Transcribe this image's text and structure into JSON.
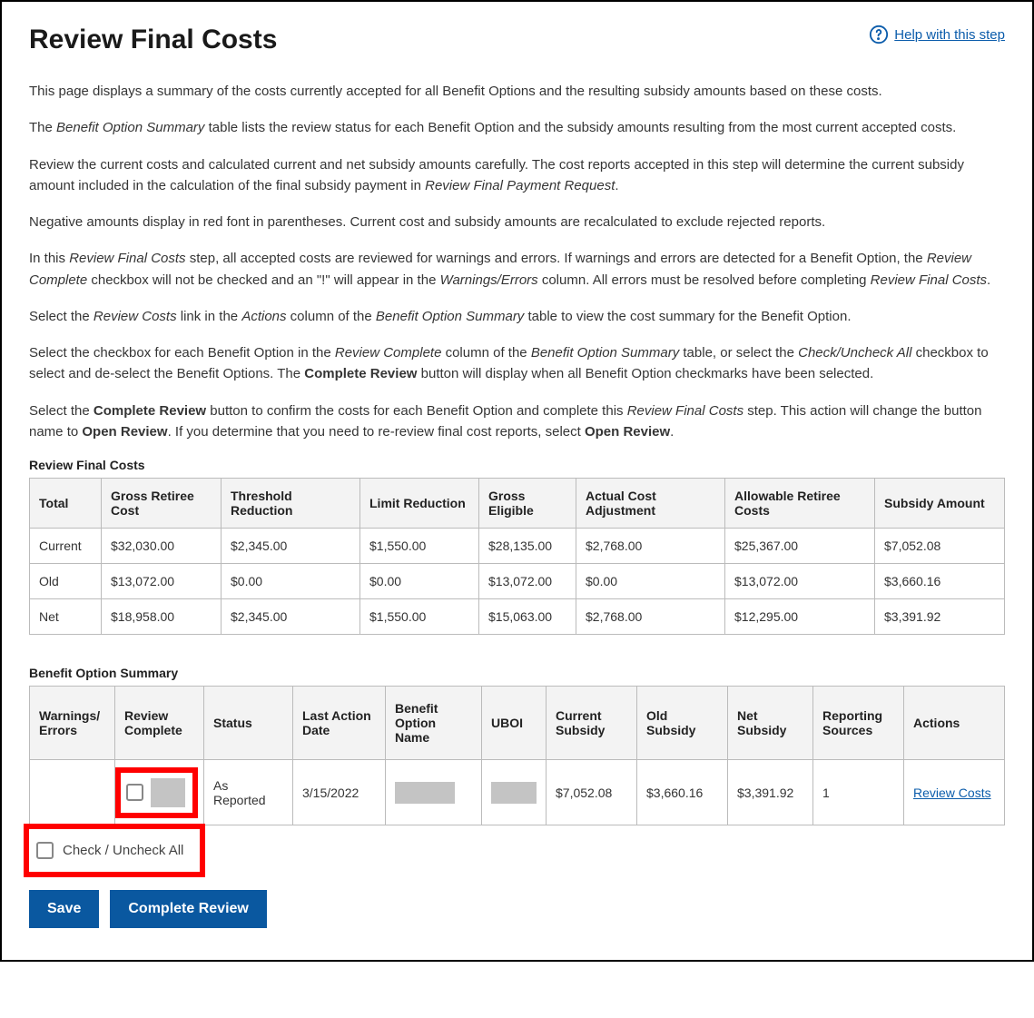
{
  "header": {
    "title": "Review Final Costs",
    "help_label": "Help with this step"
  },
  "intro": {
    "p1": "This page displays a summary of the costs currently accepted for all Benefit Options and the resulting subsidy amounts based on these costs.",
    "p2_a": "The ",
    "p2_b": "Benefit Option Summary",
    "p2_c": " table lists the review status for each Benefit Option and the subsidy amounts resulting from the most current accepted costs.",
    "p3_a": "Review the current costs and calculated current and net subsidy amounts carefully. The cost reports accepted in this step will determine the current subsidy amount included in the calculation of the final subsidy payment in ",
    "p3_b": "Review Final Payment Request",
    "p3_c": ".",
    "p4": "Negative amounts display in red font in parentheses. Current cost and subsidy amounts are recalculated to exclude rejected reports.",
    "p5_a": "In this ",
    "p5_b": "Review Final Costs",
    "p5_c": " step, all accepted costs are reviewed for warnings and errors. If warnings and errors are detected for a Benefit Option, the ",
    "p5_d": "Review Complete",
    "p5_e": " checkbox will not be checked and an \"!\" will appear in the ",
    "p5_f": "Warnings/Errors",
    "p5_g": " column. All errors must be resolved before completing ",
    "p5_h": "Review Final Costs",
    "p5_i": ".",
    "p6_a": "Select the ",
    "p6_b": "Review Costs",
    "p6_c": " link in the ",
    "p6_d": "Actions",
    "p6_e": " column of the ",
    "p6_f": "Benefit Option Summary",
    "p6_g": " table to view the cost summary for the Benefit Option.",
    "p7_a": "Select the checkbox for each Benefit Option in the ",
    "p7_b": "Review Complete",
    "p7_c": " column of the ",
    "p7_d": "Benefit Option Summary",
    "p7_e": " table, or select the ",
    "p7_f": "Check/Uncheck All",
    "p7_g": " checkbox to select and de-select the Benefit Options. The ",
    "p7_h": "Complete Review",
    "p7_i": " button will display when all Benefit Option checkmarks have been selected.",
    "p8_a": "Select the ",
    "p8_b": "Complete Review",
    "p8_c": " button to confirm the costs for each Benefit Option and complete this ",
    "p8_d": "Review Final Costs",
    "p8_e": " step. This action will change the button name to ",
    "p8_f": "Open Review",
    "p8_g": ". If you determine that you need to re-review final cost reports, select ",
    "p8_h": "Open Review",
    "p8_i": "."
  },
  "cost_table": {
    "caption": "Review Final Costs",
    "headers": {
      "total": "Total",
      "gross_retiree": "Gross Retiree Cost",
      "threshold": "Threshold Reduction",
      "limit": "Limit Reduction",
      "gross_eligible": "Gross Eligible",
      "actual_adj": "Actual Cost Adjustment",
      "allowable": "Allowable Retiree Costs",
      "subsidy": "Subsidy Amount"
    },
    "rows": [
      {
        "label": "Current",
        "gross_retiree": "$32,030.00",
        "threshold": "$2,345.00",
        "limit": "$1,550.00",
        "gross_eligible": "$28,135.00",
        "actual_adj": "$2,768.00",
        "allowable": "$25,367.00",
        "subsidy": "$7,052.08"
      },
      {
        "label": "Old",
        "gross_retiree": "$13,072.00",
        "threshold": "$0.00",
        "limit": "$0.00",
        "gross_eligible": "$13,072.00",
        "actual_adj": "$0.00",
        "allowable": "$13,072.00",
        "subsidy": "$3,660.16"
      },
      {
        "label": "Net",
        "gross_retiree": "$18,958.00",
        "threshold": "$2,345.00",
        "limit": "$1,550.00",
        "gross_eligible": "$15,063.00",
        "actual_adj": "$2,768.00",
        "allowable": "$12,295.00",
        "subsidy": "$3,391.92"
      }
    ]
  },
  "bo_table": {
    "caption": "Benefit Option Summary",
    "headers": {
      "warnings": "Warnings/ Errors",
      "review_complete": "Review Complete",
      "status": "Status",
      "last_action": "Last Action Date",
      "bo_name": "Benefit Option Name",
      "uboi": "UBOI",
      "current_sub": "Current Subsidy",
      "old_sub": "Old Subsidy",
      "net_sub": "Net Subsidy",
      "reporting": "Reporting Sources",
      "actions": "Actions"
    },
    "rows": [
      {
        "warnings": "",
        "status": "As Reported",
        "last_action": "3/15/2022",
        "current_sub": "$7,052.08",
        "old_sub": "$3,660.16",
        "net_sub": "$3,391.92",
        "reporting": "1",
        "action_label": "Review Costs"
      }
    ]
  },
  "check_all_label": "Check / Uncheck All",
  "buttons": {
    "save": "Save",
    "complete": "Complete Review"
  }
}
